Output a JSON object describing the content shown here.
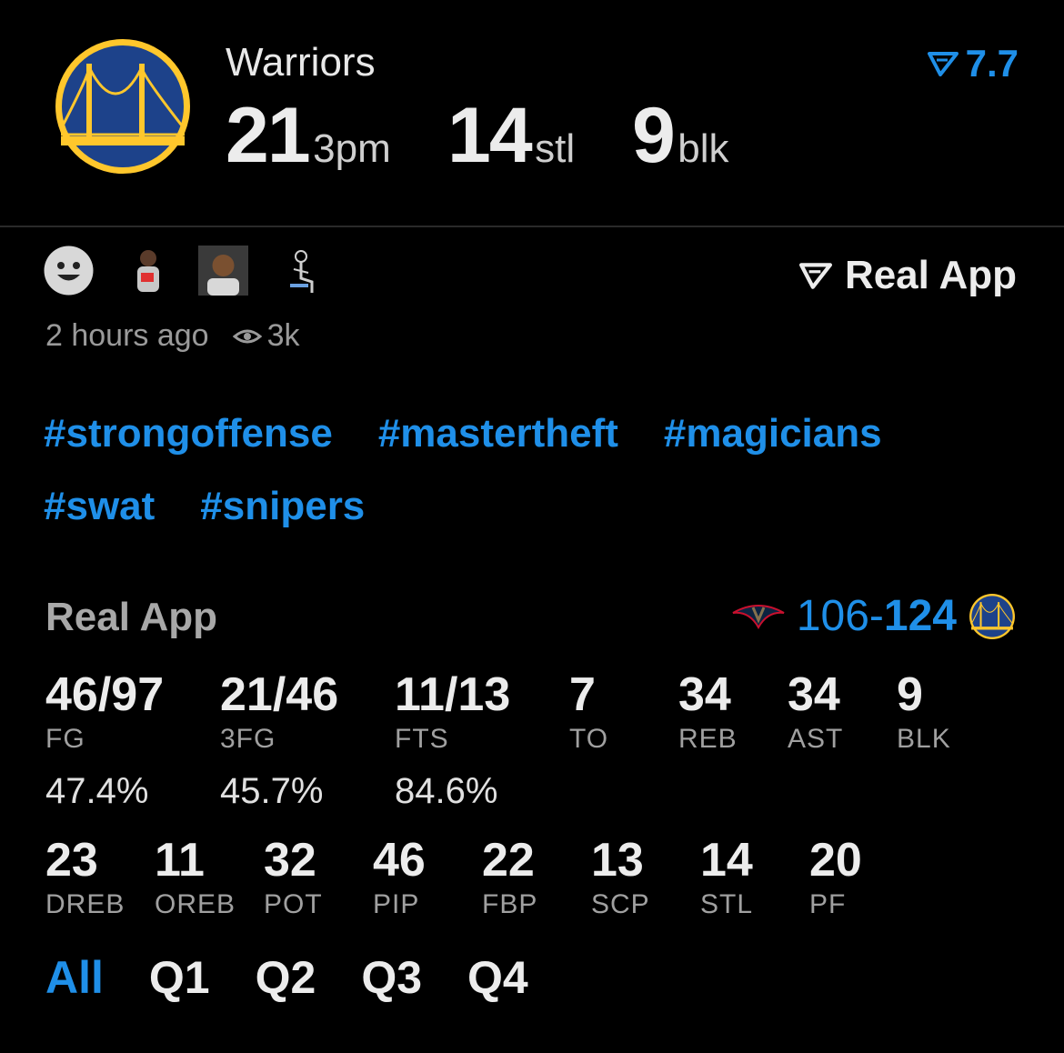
{
  "header": {
    "team_name": "Warriors",
    "stats": [
      {
        "value": "21",
        "unit": "3pm"
      },
      {
        "value": "14",
        "unit": "stl"
      },
      {
        "value": "9",
        "unit": "blk"
      }
    ],
    "rating": "7.7"
  },
  "post": {
    "source": "Real App",
    "time_ago": "2 hours ago",
    "views": "3k",
    "tags": [
      "#strongoffense",
      "#mastertheft",
      "#magicians",
      "#swat",
      "#snipers"
    ]
  },
  "boxscore": {
    "title": "Real App",
    "score_left": "106",
    "score_sep": "-",
    "score_right": "124",
    "row1": [
      {
        "value": "46/97",
        "label": "FG"
      },
      {
        "value": "21/46",
        "label": "3FG"
      },
      {
        "value": "11/13",
        "label": "FTS"
      },
      {
        "value": "7",
        "label": "TO"
      },
      {
        "value": "34",
        "label": "REB"
      },
      {
        "value": "34",
        "label": "AST"
      },
      {
        "value": "9",
        "label": "BLK"
      }
    ],
    "percentages": [
      "47.4%",
      "45.7%",
      "84.6%"
    ],
    "row2": [
      {
        "value": "23",
        "label": "DREB"
      },
      {
        "value": "11",
        "label": "OREB"
      },
      {
        "value": "32",
        "label": "POT"
      },
      {
        "value": "46",
        "label": "PIP"
      },
      {
        "value": "22",
        "label": "FBP"
      },
      {
        "value": "13",
        "label": "SCP"
      },
      {
        "value": "14",
        "label": "STL"
      },
      {
        "value": "20",
        "label": "PF"
      }
    ],
    "quarters": [
      "All",
      "Q1",
      "Q2",
      "Q3",
      "Q4"
    ],
    "active_quarter": "All"
  },
  "colors": {
    "accent": "#1f8fe8",
    "background": "#000000",
    "warriors_blue": "#1d428a",
    "warriors_gold": "#ffc72c"
  }
}
